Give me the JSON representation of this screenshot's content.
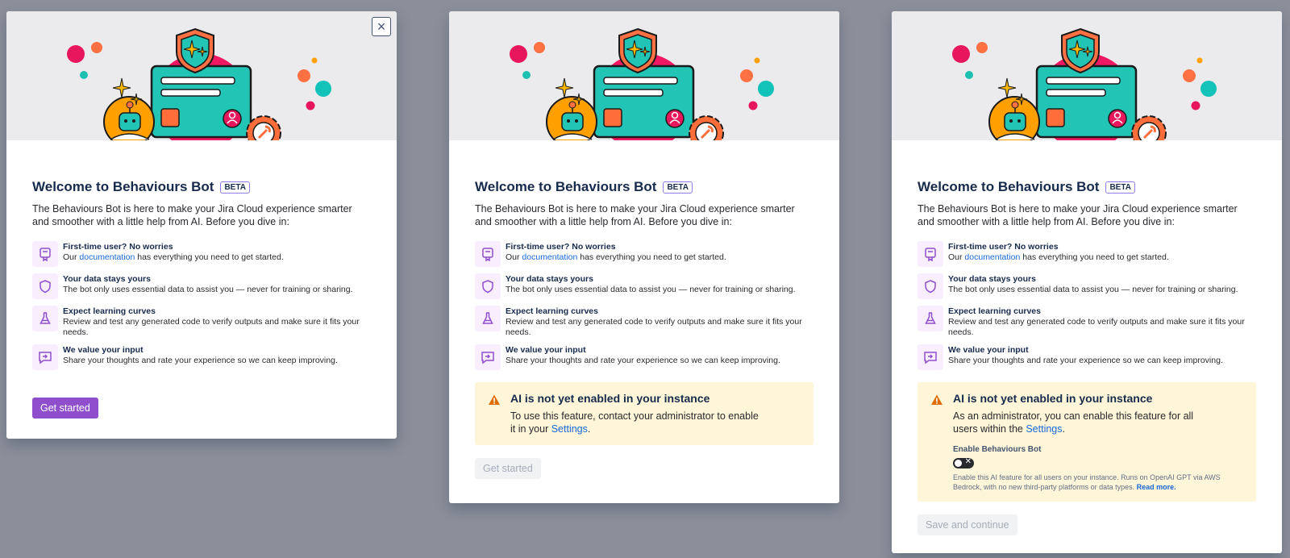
{
  "common": {
    "title": "Welcome to Behaviours Bot",
    "beta": "BETA",
    "intro": "The Behaviours Bot is here to make your Jira Cloud experience smarter and smoother with a little help from AI. Before you dive in:",
    "features": [
      {
        "icon": "certificate-icon",
        "title": "First-time user? No worries",
        "pre": "Our ",
        "link": "documentation",
        "post": " has everything you need to get started."
      },
      {
        "icon": "shield-icon",
        "title": "Your data stays yours",
        "text": "The bot only uses essential data to assist you — never for training or sharing."
      },
      {
        "icon": "flask-icon",
        "title": "Expect learning curves",
        "text": "Review and test any generated code to verify outputs and make sure it fits your needs."
      },
      {
        "icon": "feedback-icon",
        "title": "We value your input",
        "text": "Share your thoughts and rate your experience so we can keep improving."
      }
    ]
  },
  "modal1": {
    "close_symbol": "×",
    "button": "Get started"
  },
  "modal2": {
    "warn_title": "AI is not yet enabled in your instance",
    "warn_pre": "To use this feature, contact your administrator to enable it in your ",
    "warn_link": "Settings",
    "warn_post": ".",
    "button": "Get started"
  },
  "modal3": {
    "warn_title": "AI is not yet enabled in your instance",
    "warn_pre": "As an administrator, you can enable this feature for all users within the ",
    "warn_link": "Settings",
    "warn_post": ".",
    "toggle_label": "Enable Behaviours Bot",
    "toggle_symbol": "✕",
    "toggle_help": "Enable this AI feature for all users on your instance. Runs on OpenAI GPT via AWS Bedrock, with no new third-party platforms or data types. ",
    "toggle_link": "Read more.",
    "button": "Save and continue"
  },
  "colors": {
    "primary_button": "#8f4fcc",
    "link": "#1868db",
    "warning_bg": "#fff5d8",
    "warning_icon": "#e06c00",
    "icon_tile": "#f8eefe"
  }
}
